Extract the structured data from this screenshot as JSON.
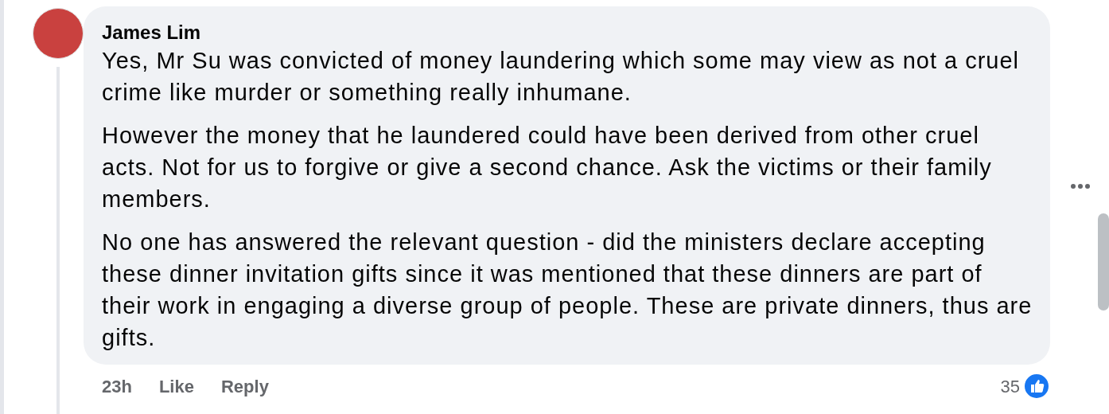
{
  "comment": {
    "author": "James Lim",
    "paragraphs": [
      "Yes, Mr Su was convicted of money laundering which some may view as not a cruel crime like murder or something really inhumane.",
      "However the money that he laundered could have been derived from other cruel acts. Not for us to forgive or give a second chance. Ask the victims or their family members.",
      "No one has answered the relevant question - did the ministers declare accepting these dinner invitation gifts since it was mentioned that these dinners are part of their work in engaging a diverse group of people. These are private dinners, thus are gifts."
    ],
    "time": "23h",
    "actions": [
      "Like",
      "Reply"
    ],
    "reaction_count": "35"
  }
}
